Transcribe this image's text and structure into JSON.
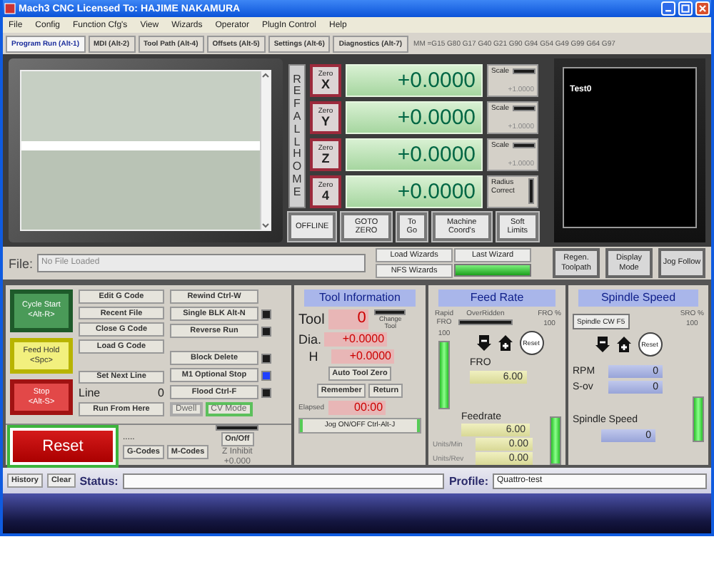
{
  "window": {
    "title": "Mach3 CNC  Licensed To: HAJIME NAKAMURA"
  },
  "menu": [
    "File",
    "Config",
    "Function Cfg's",
    "View",
    "Wizards",
    "Operator",
    "PlugIn Control",
    "Help"
  ],
  "tabs": [
    {
      "label": "Program Run (Alt-1)",
      "selected": true
    },
    {
      "label": "MDI (Alt-2)",
      "selected": false
    },
    {
      "label": "Tool Path (Alt-4)",
      "selected": false
    },
    {
      "label": "Offsets (Alt-5)",
      "selected": false
    },
    {
      "label": "Settings (Alt-6)",
      "selected": false
    },
    {
      "label": "Diagnostics (Alt-7)",
      "selected": false
    }
  ],
  "modal_codes": "MM =G15  G80 G17 G40 G21 G90 G94 G54 G49 G99 G64 G97",
  "ref_all_home": "REF ALL HOME",
  "axes": [
    {
      "kind": "scale",
      "zero": "Zero",
      "axis": "X",
      "value": "+0.0000",
      "side_label": "Scale",
      "side_value": "+1.0000",
      "led_on": false
    },
    {
      "kind": "scale",
      "zero": "Zero",
      "axis": "Y",
      "value": "+0.0000",
      "side_label": "Scale",
      "side_value": "+1.0000",
      "led_on": false
    },
    {
      "kind": "scale",
      "zero": "Zero",
      "axis": "Z",
      "value": "+0.0000",
      "side_label": "Scale",
      "side_value": "+1.0000",
      "led_on": false
    },
    {
      "kind": "radius",
      "zero": "Zero",
      "axis": "4",
      "value": "+0.0000",
      "side_label": "Radius Correct",
      "led_on": false
    }
  ],
  "dro_buttons": [
    "OFFLINE",
    "GOTO ZERO",
    "To Go",
    "Machine Coord's",
    "Soft Limits"
  ],
  "toolpath": {
    "label": "Test0"
  },
  "file": {
    "label": "File:",
    "value": "No File Loaded"
  },
  "wizards": {
    "load": "Load Wizards",
    "last": "Last Wizard",
    "nfs": "NFS Wizards",
    "last_on": true
  },
  "view_buttons": [
    "Regen. Toolpath",
    "Display Mode",
    "Jog Follow"
  ],
  "run_buttons": [
    {
      "kind": "start",
      "label": "Cycle Start",
      "key": "<Alt-R>"
    },
    {
      "kind": "hold",
      "label": "Feed Hold",
      "key": "<Spc>"
    },
    {
      "kind": "stop",
      "label": "Stop",
      "key": "<Alt-S>"
    }
  ],
  "file_buttons": [
    "Edit G Code",
    "Recent File",
    "Close G Code",
    "Load G Code"
  ],
  "set_next_line": "Set Next Line",
  "line": {
    "label": "Line",
    "value": "0"
  },
  "run_from_here": "Run From Here",
  "options_top": [
    {
      "kind": "plain",
      "label": "Rewind Ctrl-W"
    },
    {
      "kind": "toggle",
      "label": "Single BLK Alt-N",
      "on": false
    },
    {
      "kind": "toggle",
      "label": "Reverse Run",
      "on": false
    }
  ],
  "options_bottom": [
    {
      "kind": "toggle",
      "label": "Block Delete",
      "on": false
    },
    {
      "kind": "toggle",
      "label": "M1 Optional Stop",
      "on": true
    },
    {
      "kind": "toggle",
      "label": "Flood Ctrl-F",
      "on": false
    }
  ],
  "modes": [
    {
      "label": "Dwell",
      "on": false
    },
    {
      "label": "CV Mode",
      "on": true
    }
  ],
  "reset": "Reset",
  "code_lists": {
    "dots": ".....",
    "buttons": [
      "G-Codes",
      "M-Codes"
    ]
  },
  "z_inhibit": {
    "button": "On/Off",
    "on": false,
    "label": "Z Inhibit",
    "value": "+0.000"
  },
  "tool_info": {
    "title": "Tool Information",
    "tool_label": "Tool",
    "tool": "0",
    "change": "Change Tool",
    "change_on": false,
    "dia_label": "Dia.",
    "dia": "+0.0000",
    "h_label": "H",
    "h": "+0.0000",
    "auto_zero": "Auto Tool Zero",
    "remember": "Remember",
    "return": "Return",
    "elapsed_label": "Elapsed",
    "elapsed": "00:00",
    "jog": "Jog ON/OFF Ctrl-Alt-J"
  },
  "feed_rate": {
    "title": "Feed Rate",
    "overridden": "OverRidden",
    "overridden_on": false,
    "fro_pct_label": "FRO %",
    "fro_pct": "100",
    "rapid_label": "Rapid FRO",
    "rapid": "100",
    "rapid_slider": {
      "level": 1
    },
    "reset": "Reset",
    "fro_label": "FRO",
    "fro": "6.00",
    "feedrate_label": "Feedrate",
    "feedrate": "6.00",
    "units_min_label": "Units/Min",
    "units_min": "0.00",
    "units_rev_label": "Units/Rev",
    "units_rev": "0.00",
    "fro_slider": {
      "level": 1
    }
  },
  "spindle": {
    "title": "Spindle Speed",
    "cw": "Spindle CW F5",
    "sro_pct_label": "SRO %",
    "sro_pct": "100",
    "reset": "Reset",
    "rpm_label": "RPM",
    "rpm": "0",
    "sov_label": "S-ov",
    "sov": "0",
    "speed_label": "Spindle Speed",
    "speed": "0",
    "slider": {
      "level": 1
    }
  },
  "status": {
    "history": "History",
    "clear": "Clear",
    "status_label": "Status:",
    "profile_label": "Profile:",
    "profile": "Quattro-test"
  }
}
